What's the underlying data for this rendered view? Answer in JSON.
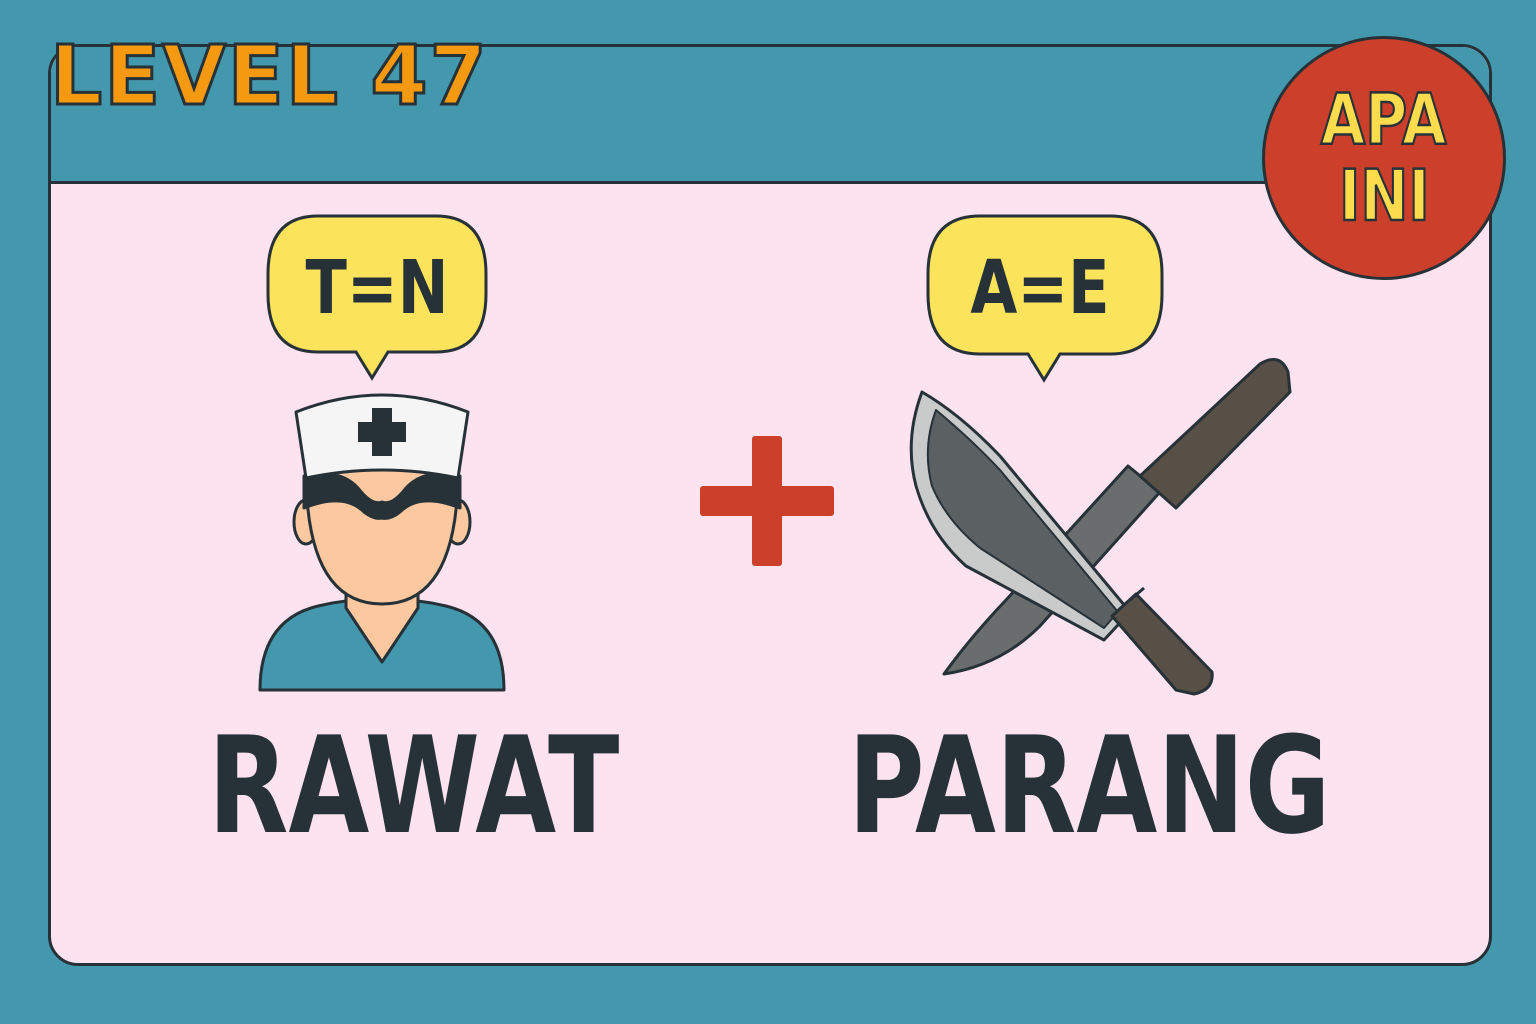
{
  "header": {
    "level_label": "LEVEL 47"
  },
  "badge": {
    "line1": "APA",
    "line2": "INI"
  },
  "clues": [
    {
      "hint": "T=N",
      "word": "RAWAT",
      "icon": "nurse-icon"
    },
    {
      "hint": "A=E",
      "word": "PARANG",
      "icon": "machete-icon"
    }
  ],
  "operator": "plus-icon",
  "colors": {
    "background": "#4498ad",
    "card": "#fde3f0",
    "level_text": "#f59a10",
    "badge": "#cb3f2b",
    "badge_text": "#fcdb4d",
    "bubble": "#fce35c",
    "plus": "#cb3f2b",
    "ink": "#263238"
  }
}
